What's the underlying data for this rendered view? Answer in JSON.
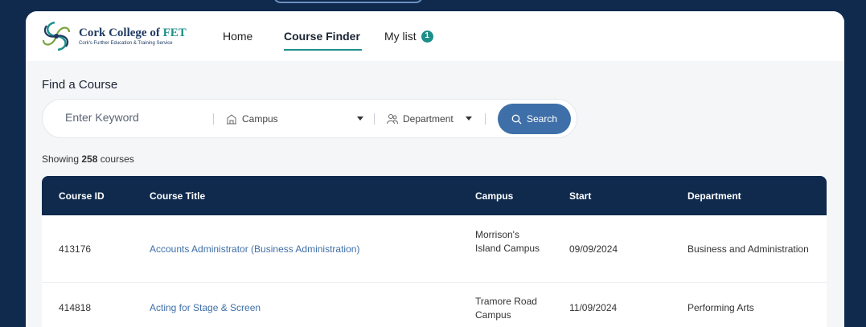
{
  "brand": {
    "name": "Cork College of",
    "name_accent": "FET",
    "tagline": "Cork's Further Education & Training Service"
  },
  "nav": {
    "home": "Home",
    "course_finder": "Course Finder",
    "my_list": "My list",
    "my_list_count": "1"
  },
  "page": {
    "heading": "Find a Course"
  },
  "search": {
    "keyword_placeholder": "Enter Keyword",
    "campus_label": "Campus",
    "department_label": "Department",
    "button_label": "Search"
  },
  "results": {
    "prefix": "Showing",
    "count": "258",
    "suffix": "courses"
  },
  "table": {
    "headers": [
      "Course ID",
      "Course Title",
      "Campus",
      "Start",
      "Department"
    ],
    "rows": [
      {
        "id": "413176",
        "title": "Accounts Administrator (Business Administration)",
        "campus": "Morrison's Island Campus",
        "start": "09/09/2024",
        "department": "Business and Administration"
      },
      {
        "id": "414818",
        "title": "Acting for Stage & Screen",
        "campus": "Tramore Road Campus",
        "start": "11/09/2024",
        "department": "Performing Arts"
      }
    ]
  },
  "colors": {
    "navy": "#0f2a4d",
    "teal": "#1d8f8a",
    "link_blue": "#3f6fa8"
  }
}
